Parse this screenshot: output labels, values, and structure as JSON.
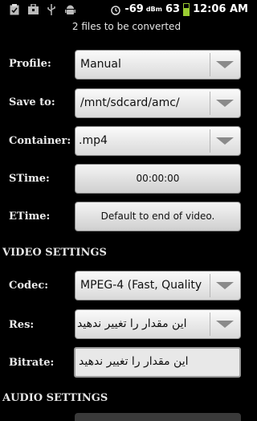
{
  "status_bar": {
    "signal_dbm": "-69",
    "dbm_unit": "dBm",
    "battery_percent": "63",
    "time": "12:06 AM",
    "icons": [
      "clipboard-icon",
      "bag-icon",
      "usb-icon",
      "android-icon",
      "alarm-icon"
    ]
  },
  "header": {
    "files_message": "2  files to be converted"
  },
  "fields": {
    "profile": {
      "label": "Profile:",
      "value": "Manual"
    },
    "save_to": {
      "label": "Save to:",
      "value": "/mnt/sdcard/amc/"
    },
    "container": {
      "label": "Container:",
      "value": ".mp4"
    },
    "stime": {
      "label": "STime:",
      "value": "00:00:00"
    },
    "etime": {
      "label": "ETime:",
      "value": "Default to end of video."
    }
  },
  "video_settings": {
    "title": "VIDEO SETTINGS",
    "codec": {
      "label": "Codec:",
      "value": "MPEG-4 (Fast, Quality"
    },
    "res": {
      "label": "Res:",
      "value": "این مقدار را تغییر ندهید"
    },
    "bitrate": {
      "label": "Bitrate:",
      "value": "این مقدار را تغییر ندهید"
    }
  },
  "audio_settings": {
    "title": "AUDIO SETTINGS"
  }
}
